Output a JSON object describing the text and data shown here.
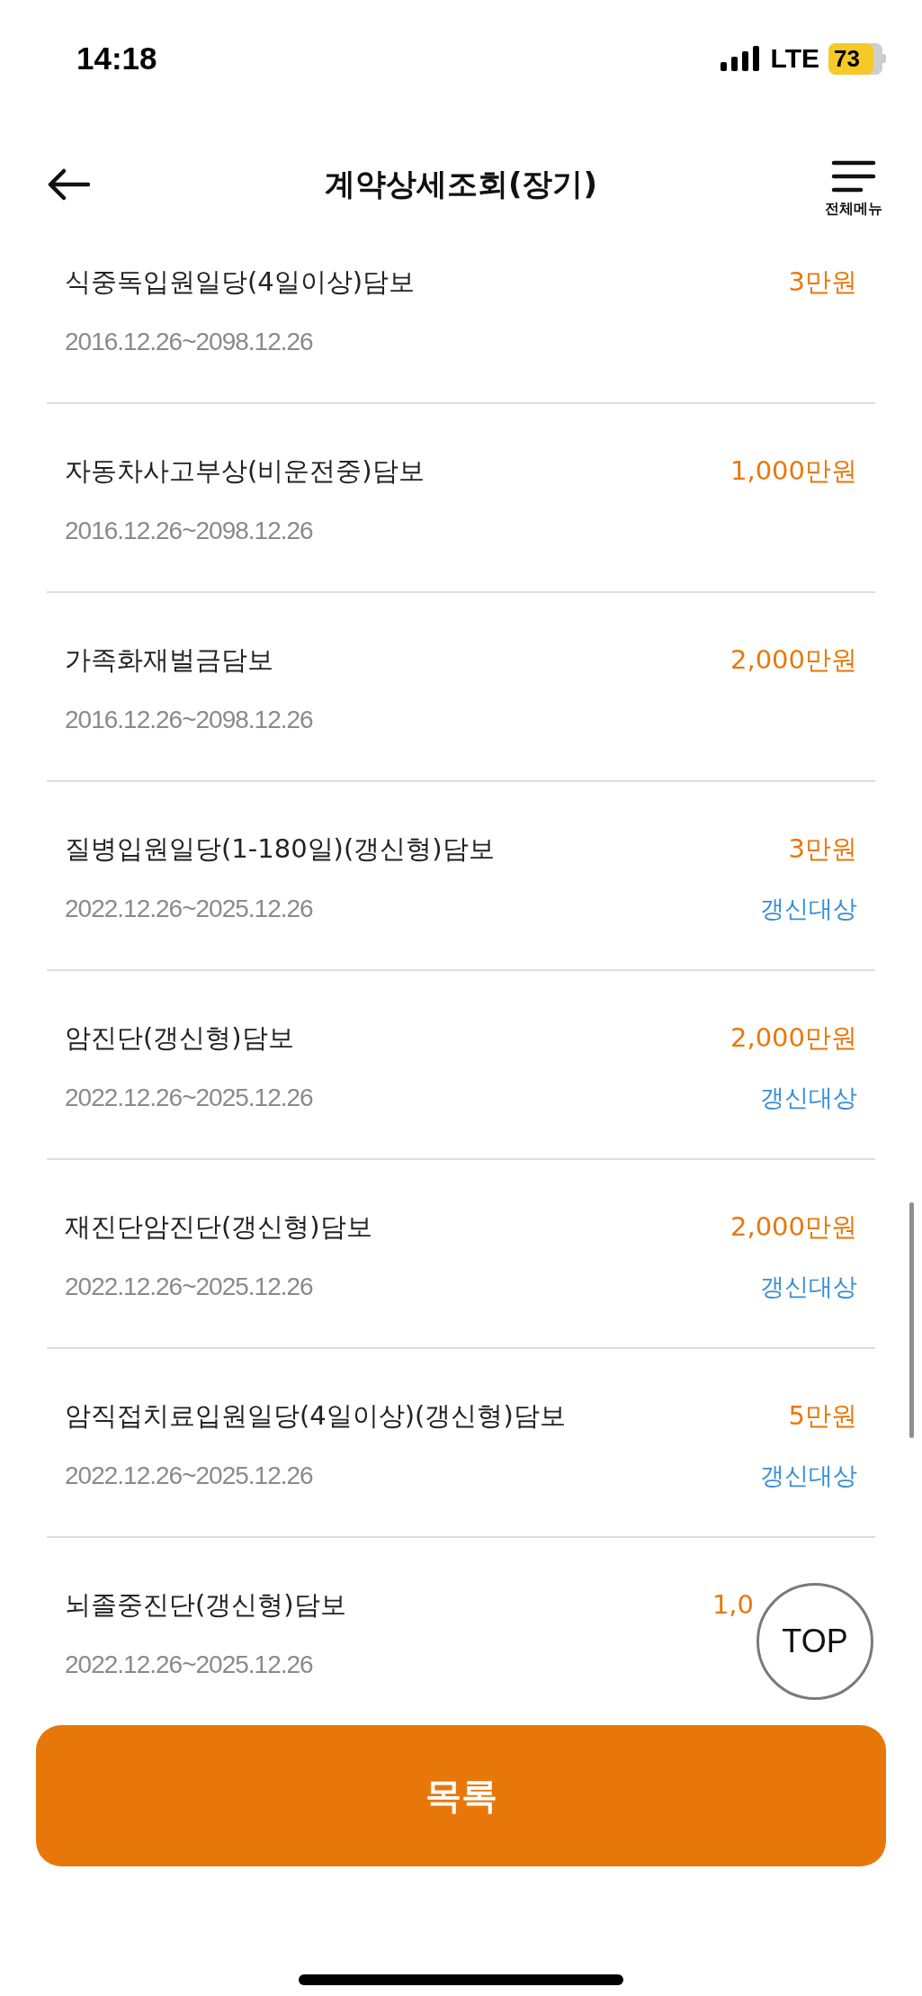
{
  "status_bar": {
    "time": "14:18",
    "network": "LTE",
    "battery": "73"
  },
  "header": {
    "title": "계약상세조회(장기)",
    "menu_label": "전체메뉴"
  },
  "coverages": [
    {
      "name": "식중독입원일당(4일이상)담보",
      "period": "2016.12.26~2098.12.26",
      "amount": "3만원"
    },
    {
      "name": "자동차사고부상(비운전중)담보",
      "period": "2016.12.26~2098.12.26",
      "amount": "1,000만원"
    },
    {
      "name": "가족화재벌금담보",
      "period": "2016.12.26~2098.12.26",
      "amount": "2,000만원"
    },
    {
      "name": "질병입원일당(1-180일)(갱신형)담보",
      "period": "2022.12.26~2025.12.26",
      "amount": "3만원",
      "status": "갱신대상"
    },
    {
      "name": "암진단(갱신형)담보",
      "period": "2022.12.26~2025.12.26",
      "amount": "2,000만원",
      "status": "갱신대상"
    },
    {
      "name": "재진단암진단(갱신형)담보",
      "period": "2022.12.26~2025.12.26",
      "amount": "2,000만원",
      "status": "갱신대상"
    },
    {
      "name": "암직접치료입원일당(4일이상)(갱신형)담보",
      "period": "2022.12.26~2025.12.26",
      "amount": "5만원",
      "status": "갱신대상"
    },
    {
      "name": "뇌졸중진단(갱신형)담보",
      "period": "2022.12.26~2025.12.26",
      "amount": "1,0"
    }
  ],
  "top_button": "TOP",
  "list_button": "목록"
}
